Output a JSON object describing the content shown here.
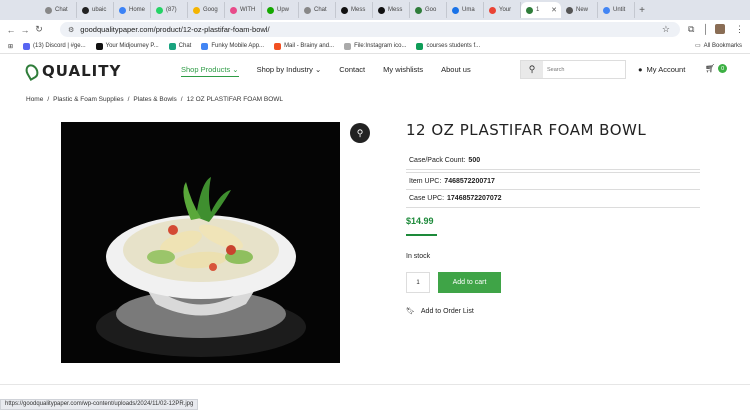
{
  "browser": {
    "tabs": [
      {
        "label": "Chat",
        "icon": "chatgpt-icon"
      },
      {
        "label": "ubaic",
        "icon": "github-icon"
      },
      {
        "label": "Home",
        "icon": "home-icon"
      },
      {
        "label": "(87)",
        "icon": "whatsapp-icon"
      },
      {
        "label": "Goog",
        "icon": "google-drive-icon"
      },
      {
        "label": "WITH",
        "icon": "wit-icon"
      },
      {
        "label": "Upw",
        "icon": "upwork-icon"
      },
      {
        "label": "Chat",
        "icon": "chatgpt-icon"
      },
      {
        "label": "Mess",
        "icon": "messenger-icon"
      },
      {
        "label": "Mess",
        "icon": "messenger-icon"
      },
      {
        "label": "Goo",
        "icon": "quality-icon"
      },
      {
        "label": "Uma",
        "icon": "uma-icon"
      },
      {
        "label": "Your",
        "icon": "gmail-icon"
      },
      {
        "label": "1",
        "icon": "quality-icon",
        "active": true
      },
      {
        "label": "New",
        "icon": "new-tab-icon"
      },
      {
        "label": "Untit",
        "icon": "docs-icon"
      }
    ],
    "url": "goodqualitypaper.com/product/12-oz-plastifar-foam-bowl/",
    "bookmarks": [
      {
        "label": "(13) Discord | #ge..."
      },
      {
        "label": "Your Midjourney P..."
      },
      {
        "label": "Chat"
      },
      {
        "label": "Funky Mobile App..."
      },
      {
        "label": "Mail - Brainy and..."
      },
      {
        "label": "File:Instagram ico..."
      },
      {
        "label": "courses students f..."
      }
    ],
    "all_bookmarks": "All Bookmarks",
    "status_url": "https://goodqualitypaper.com/wp-content/uploads/2024/11/02-12PR.jpg"
  },
  "site": {
    "logo": "QUALITY",
    "nav": [
      {
        "label": "Shop Products",
        "has_dropdown": true,
        "active": true
      },
      {
        "label": "Shop by Industry",
        "has_dropdown": true
      },
      {
        "label": "Contact"
      },
      {
        "label": "My wishlists"
      },
      {
        "label": "About us"
      }
    ],
    "search_placeholder": "Search",
    "account_label": "My Account",
    "cart_count": "0",
    "accent": "#3fa447"
  },
  "breadcrumb": [
    "Home",
    "Plastic & Foam Supplies",
    "Plates & Bowls",
    "12 OZ PLASTIFAR FOAM BOWL"
  ],
  "product": {
    "title": "12 OZ PLASTIFAR FOAM BOWL",
    "specs": [
      {
        "label": "Case/Pack Count:",
        "value": "500"
      },
      {
        "label": "Item UPC:",
        "value": "7468572200717"
      },
      {
        "label": "Case UPC:",
        "value": "17468572207072"
      }
    ],
    "price": "$14.99",
    "stock": "In stock",
    "quantity": "1",
    "add_to_cart": "Add to cart",
    "add_to_order_list": "Add to Order List"
  }
}
